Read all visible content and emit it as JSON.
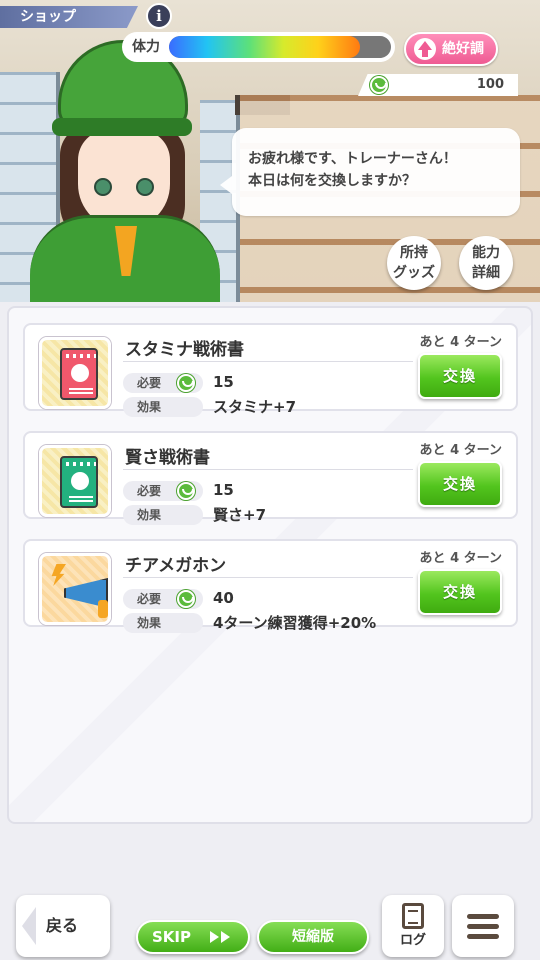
{
  "header": {
    "screen_title": "ショップ",
    "info_label": "i",
    "stamina_label": "体力",
    "stamina_fraction": 0.86,
    "mood_label": "絶好調"
  },
  "wallet": {
    "coins": "100",
    "coin_icon": "coin-icon"
  },
  "dialogue": {
    "line1": "お疲れ様です、トレーナーさん！",
    "line2": "本日は何を交換しますか？"
  },
  "side_buttons": {
    "owned_goods_line1": "所持",
    "owned_goods_line2": "グッズ",
    "ability_line1": "能力",
    "ability_line2": "詳細"
  },
  "labels": {
    "cost": "必要",
    "effect": "効果",
    "exchange": "交換"
  },
  "items": [
    {
      "name": "スタミナ戦術書",
      "turns_left": "あと 4 ターン",
      "cost": "15",
      "effect": "スタミナ+7",
      "icon": "red-book-icon"
    },
    {
      "name": "賢さ戦術書",
      "turns_left": "あと 4 ターン",
      "cost": "15",
      "effect": "賢さ+7",
      "icon": "green-book-icon"
    },
    {
      "name": "チアメガホン",
      "turns_left": "あと 4 ターン",
      "cost": "40",
      "effect": "4ターン練習獲得+20%",
      "icon": "megaphone-icon"
    }
  ],
  "footer": {
    "back_label": "戻る",
    "skip_label": "SKIP",
    "short_label": "短縮版",
    "log_label": "ログ"
  },
  "colors": {
    "exchange_green": "#53c51e",
    "mood_pink": "#ef5b93",
    "title_blue": "#5f6fa0"
  }
}
